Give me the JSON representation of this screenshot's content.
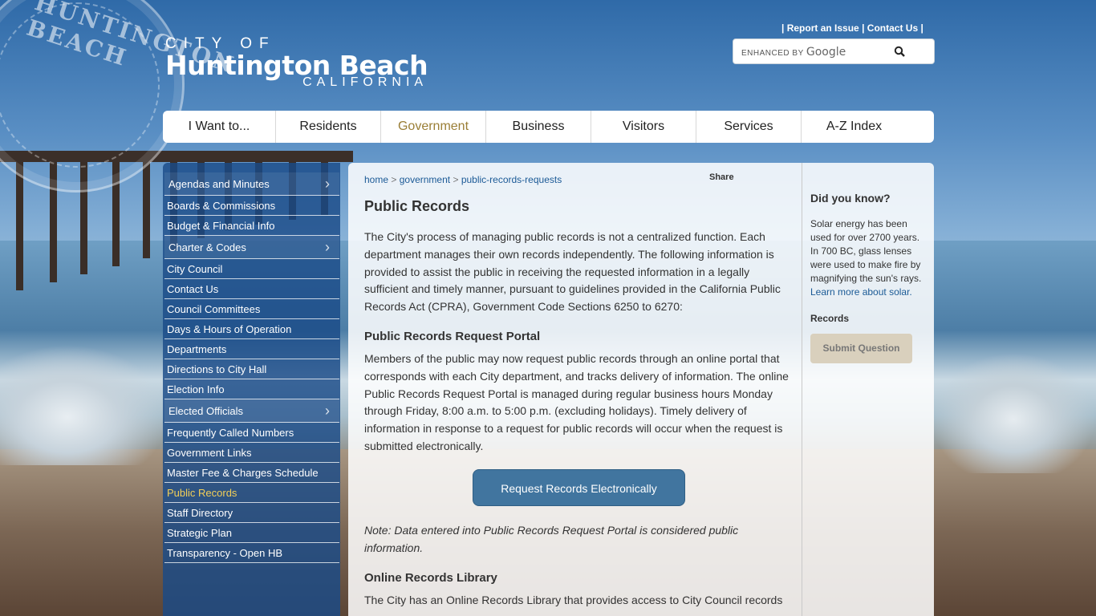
{
  "header": {
    "logo_city": "CITY OF",
    "logo_name": "Huntington Beach",
    "logo_state": "CALIFORNIA",
    "seal_text": "HUNTINGTON BEACH",
    "util_sep": "|",
    "report_issue": "Report an Issue",
    "contact_us": "Contact Us",
    "search_enhanced": "ENHANCED BY",
    "search_google": "Google",
    "search_icon": "search-icon"
  },
  "main_nav": [
    {
      "label": "I Want to..."
    },
    {
      "label": "Residents"
    },
    {
      "label": "Government"
    },
    {
      "label": "Business"
    },
    {
      "label": "Visitors"
    },
    {
      "label": "Services"
    },
    {
      "label": "A-Z Index"
    }
  ],
  "sidebar": {
    "items": [
      {
        "label": "Agendas and Minutes"
      },
      {
        "label": "Boards & Commissions"
      },
      {
        "label": "Budget & Financial Info"
      },
      {
        "label": "Charter & Codes"
      },
      {
        "label": "City Council"
      },
      {
        "label": "Contact Us"
      },
      {
        "label": "Council Committees"
      },
      {
        "label": "Days & Hours of Operation"
      },
      {
        "label": "Departments"
      },
      {
        "label": "Directions to City Hall"
      },
      {
        "label": "Election Info"
      },
      {
        "label": "Elected Officials"
      },
      {
        "label": "Frequently Called Numbers"
      },
      {
        "label": "Government Links"
      },
      {
        "label": "Master Fee & Charges Schedule"
      },
      {
        "label": "Public Records"
      },
      {
        "label": "Staff Directory"
      },
      {
        "label": "Strategic Plan"
      },
      {
        "label": "Transparency - Open HB"
      }
    ],
    "chevron": "›"
  },
  "content": {
    "breadcrumb": [
      "home",
      "government",
      "public-records-requests"
    ],
    "breadcrumb_sep": ">",
    "share": "Share",
    "title": "Public Records",
    "intro": "The City's process of managing public records is not a centralized function. Each department manages their own records independently. The following information is provided to assist the public in receiving the requested information in a legally sufficient and timely manner, pursuant to guidelines provided in the California Public Records Act (CPRA), Government Code Sections 6250 to 6270:",
    "portal_title": "Public Records Request Portal",
    "portal_text": "Members of the public may now request public records through an online portal that corresponds with each City department, and tracks delivery of information. The online Public Records Request Portal is managed during regular business hours Monday through Friday, 8:00 a.m. to 5:00 p.m. (excluding holidays). Timely delivery of information in response to a request for public records will occur when the request is submitted electronically.",
    "cta_label": "Request Records Electronically",
    "note": "Note: Data entered into Public Records Request Portal is considered public information.",
    "library_title": "Online Records Library",
    "library_text": "The City has an Online Records Library that provides access to City Council records"
  },
  "rail": {
    "title": "Did you know?",
    "text": "Solar energy has been used for over 2700 years. In 700 BC, glass lenses were used to make fire by magnifying the sun's rays.",
    "link": "Learn more about solar.",
    "label": "Records",
    "button": "Submit Question"
  },
  "colors": {
    "nav_active": "#9a7e36",
    "sidebar_bg": "#1a4a87",
    "sidebar_current": "#f2cf58",
    "link": "#1b5a96",
    "cta": "#41759f"
  }
}
